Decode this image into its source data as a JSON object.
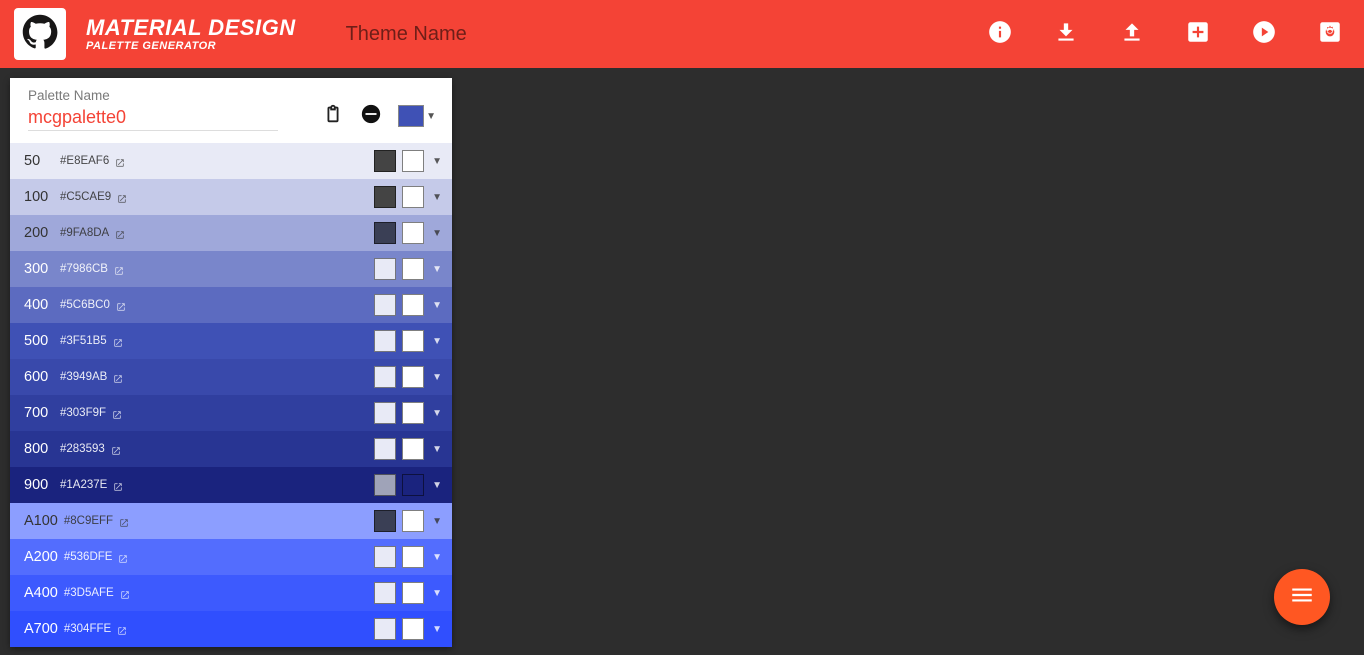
{
  "header": {
    "title_line1": "MATERIAL DESIGN",
    "title_line2": "PALETTE GENERATOR",
    "theme_placeholder": "Theme Name",
    "theme_value": ""
  },
  "palette": {
    "label": "Palette Name",
    "name": "mcgpalette0",
    "base_color": "#3F51B5",
    "shades": [
      {
        "shade": "50",
        "hex": "#E8EAF6",
        "bg": "#E8EAF6",
        "fg": "#333333",
        "sw1": "#444444",
        "sw2": "#FFFFFF"
      },
      {
        "shade": "100",
        "hex": "#C5CAE9",
        "bg": "#C5CAE9",
        "fg": "#333333",
        "sw1": "#444444",
        "sw2": "#FFFFFF"
      },
      {
        "shade": "200",
        "hex": "#9FA8DA",
        "bg": "#9FA8DA",
        "fg": "#333333",
        "sw1": "#3a3f55",
        "sw2": "#FFFFFF"
      },
      {
        "shade": "300",
        "hex": "#7986CB",
        "bg": "#7986CB",
        "fg": "#FFFFFF",
        "sw1": "#E8EAF6",
        "sw2": "#FFFFFF"
      },
      {
        "shade": "400",
        "hex": "#5C6BC0",
        "bg": "#5C6BC0",
        "fg": "#FFFFFF",
        "sw1": "#E8EAF6",
        "sw2": "#FFFFFF"
      },
      {
        "shade": "500",
        "hex": "#3F51B5",
        "bg": "#3F51B5",
        "fg": "#FFFFFF",
        "sw1": "#E8EAF6",
        "sw2": "#FFFFFF"
      },
      {
        "shade": "600",
        "hex": "#3949AB",
        "bg": "#3949AB",
        "fg": "#FFFFFF",
        "sw1": "#E8EAF6",
        "sw2": "#FFFFFF"
      },
      {
        "shade": "700",
        "hex": "#303F9F",
        "bg": "#303F9F",
        "fg": "#FFFFFF",
        "sw1": "#E8EAF6",
        "sw2": "#FFFFFF"
      },
      {
        "shade": "800",
        "hex": "#283593",
        "bg": "#283593",
        "fg": "#FFFFFF",
        "sw1": "#E8EAF6",
        "sw2": "#FFFFFF"
      },
      {
        "shade": "900",
        "hex": "#1A237E",
        "bg": "#1A237E",
        "fg": "#FFFFFF",
        "sw1": "#9fa3b8",
        "sw2": "#1A237E"
      },
      {
        "shade": "A100",
        "hex": "#8C9EFF",
        "bg": "#8C9EFF",
        "fg": "#333333",
        "sw1": "#3a3f55",
        "sw2": "#FFFFFF"
      },
      {
        "shade": "A200",
        "hex": "#536DFE",
        "bg": "#536DFE",
        "fg": "#FFFFFF",
        "sw1": "#E8EAF6",
        "sw2": "#FFFFFF"
      },
      {
        "shade": "A400",
        "hex": "#3D5AFE",
        "bg": "#3D5AFE",
        "fg": "#FFFFFF",
        "sw1": "#E8EAF6",
        "sw2": "#FFFFFF"
      },
      {
        "shade": "A700",
        "hex": "#304FFE",
        "bg": "#304FFE",
        "fg": "#FFFFFF",
        "sw1": "#E8EAF6",
        "sw2": "#FFFFFF"
      }
    ]
  },
  "icons": {
    "info": "info-icon",
    "download": "download-icon",
    "upload": "upload-icon",
    "add": "add-icon",
    "demo": "play-icon",
    "settings": "settings-icon",
    "clipboard": "clipboard-icon",
    "remove": "remove-icon",
    "menu": "menu-icon",
    "github": "github-icon"
  }
}
